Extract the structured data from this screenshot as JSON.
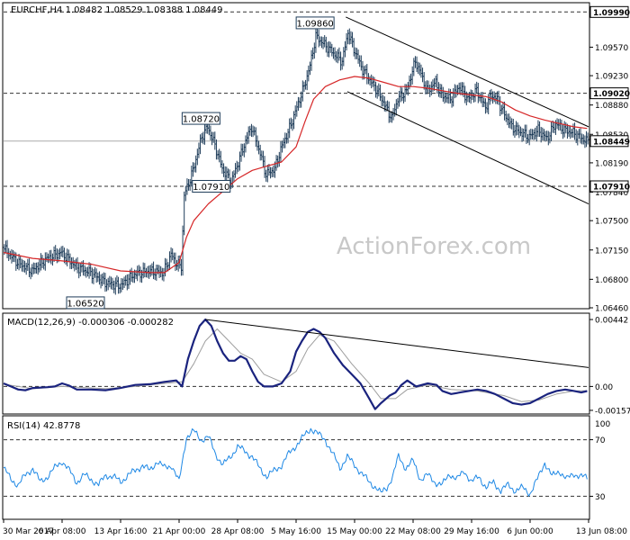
{
  "chart_data": {
    "type": "line",
    "symbol_header": "EURCHF,H4  1.08482 1.08529 1.08388 1.08449",
    "watermark": "ActionForex.com",
    "x_tick_labels": [
      "30 Mar 2017",
      "6 Apr 08:00",
      "13 Apr 16:00",
      "21 Apr 00:00",
      "28 Apr 08:00",
      "5 May 16:00",
      "15 May 00:00",
      "22 May 08:00",
      "29 May 16:00",
      "6 Jun 00:00",
      "13 Jun 08:00"
    ],
    "x_tick_index": [
      0,
      40,
      80,
      120,
      160,
      200,
      240,
      280,
      320,
      360,
      400
    ],
    "bar_count": 400,
    "price": {
      "ylim": [
        1.0646,
        1.1009
      ],
      "y_ticks": [
        1.0999,
        1.0957,
        1.0923,
        1.0888,
        1.0853,
        1.0819,
        1.0784,
        1.075,
        1.0715,
        1.068,
        1.0646
      ],
      "y_tick_labels": [
        "1.09990",
        "1.09570",
        "1.09230",
        "1.08880",
        "1.08530",
        "1.08190",
        "1.07840",
        "1.07500",
        "1.07150",
        "1.06800",
        "1.06460"
      ],
      "close_path": [
        [
          0,
          1.0718
        ],
        [
          10,
          1.07
        ],
        [
          20,
          1.069
        ],
        [
          30,
          1.0705
        ],
        [
          40,
          1.0712
        ],
        [
          50,
          1.0695
        ],
        [
          60,
          1.0688
        ],
        [
          70,
          1.0676
        ],
        [
          80,
          1.0672
        ],
        [
          90,
          1.0686
        ],
        [
          100,
          1.069
        ],
        [
          110,
          1.0688
        ],
        [
          115,
          1.071
        ],
        [
          118,
          1.07
        ],
        [
          122,
          1.0695
        ],
        [
          124,
          1.078
        ],
        [
          130,
          1.081
        ],
        [
          136,
          1.085
        ],
        [
          140,
          1.0862
        ],
        [
          145,
          1.084
        ],
        [
          150,
          1.0812
        ],
        [
          156,
          1.0796
        ],
        [
          160,
          1.0815
        ],
        [
          166,
          1.0845
        ],
        [
          170,
          1.0862
        ],
        [
          176,
          1.083
        ],
        [
          180,
          1.0805
        ],
        [
          186,
          1.0812
        ],
        [
          190,
          1.0835
        ],
        [
          196,
          1.086
        ],
        [
          200,
          1.088
        ],
        [
          206,
          1.091
        ],
        [
          210,
          1.0935
        ],
        [
          214,
          1.097
        ],
        [
          220,
          1.096
        ],
        [
          226,
          1.095
        ],
        [
          232,
          1.094
        ],
        [
          236,
          1.0975
        ],
        [
          240,
          1.0955
        ],
        [
          246,
          1.093
        ],
        [
          250,
          1.092
        ],
        [
          256,
          1.0905
        ],
        [
          262,
          1.0885
        ],
        [
          266,
          1.0872
        ],
        [
          270,
          1.0895
        ],
        [
          276,
          1.0905
        ],
        [
          282,
          1.094
        ],
        [
          286,
          1.0925
        ],
        [
          290,
          1.0905
        ],
        [
          296,
          1.0915
        ],
        [
          300,
          1.09
        ],
        [
          306,
          1.0895
        ],
        [
          312,
          1.091
        ],
        [
          318,
          1.0895
        ],
        [
          324,
          1.0905
        ],
        [
          330,
          1.0885
        ],
        [
          334,
          1.09
        ],
        [
          338,
          1.0895
        ],
        [
          342,
          1.088
        ],
        [
          348,
          1.0862
        ],
        [
          354,
          1.0855
        ],
        [
          360,
          1.085
        ],
        [
          366,
          1.0858
        ],
        [
          372,
          1.0848
        ],
        [
          378,
          1.0866
        ],
        [
          384,
          1.0858
        ],
        [
          390,
          1.0855
        ],
        [
          394,
          1.085
        ],
        [
          399,
          1.08449
        ]
      ],
      "sma_path": [
        [
          0,
          1.0712
        ],
        [
          20,
          1.0705
        ],
        [
          40,
          1.0702
        ],
        [
          60,
          1.0698
        ],
        [
          80,
          1.069
        ],
        [
          100,
          1.0688
        ],
        [
          110,
          1.0688
        ],
        [
          120,
          1.07
        ],
        [
          125,
          1.073
        ],
        [
          130,
          1.075
        ],
        [
          140,
          1.077
        ],
        [
          150,
          1.0785
        ],
        [
          160,
          1.08
        ],
        [
          170,
          1.081
        ],
        [
          180,
          1.0815
        ],
        [
          190,
          1.082
        ],
        [
          200,
          1.0838
        ],
        [
          206,
          1.0868
        ],
        [
          212,
          1.0895
        ],
        [
          220,
          1.091
        ],
        [
          230,
          1.0918
        ],
        [
          240,
          1.0922
        ],
        [
          250,
          1.092
        ],
        [
          260,
          1.0915
        ],
        [
          270,
          1.091
        ],
        [
          280,
          1.091
        ],
        [
          290,
          1.0908
        ],
        [
          300,
          1.0905
        ],
        [
          310,
          1.0902
        ],
        [
          320,
          1.09
        ],
        [
          330,
          1.0898
        ],
        [
          340,
          1.0892
        ],
        [
          350,
          1.0882
        ],
        [
          360,
          1.0875
        ],
        [
          370,
          1.087
        ],
        [
          380,
          1.0866
        ],
        [
          390,
          1.0862
        ],
        [
          399,
          1.086
        ]
      ],
      "sma_color": "#d62728",
      "bar_color": "#1f3d5a",
      "horizontal_levels": [
        1.0999,
        1.0902,
        1.0791
      ],
      "current_level": 1.08449,
      "channel_upper": [
        [
          234,
          1.0993
        ],
        [
          400,
          1.0862
        ]
      ],
      "channel_lower": [
        [
          235,
          1.0904
        ],
        [
          400,
          1.077
        ]
      ],
      "callouts": [
        {
          "label": "1.09860",
          "x": 213,
          "value": 1.0986
        },
        {
          "label": "1.08720",
          "x": 135,
          "value": 1.0872
        },
        {
          "label": "1.07910",
          "x": 142,
          "value": 1.0791
        },
        {
          "label": "1.06520",
          "x": 56,
          "value": 1.0652
        }
      ],
      "right_labels": [
        {
          "label": "1.09990",
          "value": 1.0999,
          "highlight": true
        },
        {
          "label": "1.09020",
          "value": 1.0902,
          "highlight": true
        },
        {
          "label": "1.08449",
          "value": 1.08449,
          "highlight": true
        },
        {
          "label": "1.07910",
          "value": 1.0791,
          "highlight": true
        }
      ]
    },
    "macd": {
      "title": "MACD(12,26,9) -0.000306 -0.000282",
      "ylim": [
        -0.0017,
        0.0046
      ],
      "y_ticks": [
        0.00442,
        0.0,
        -0.001578
      ],
      "y_tick_labels": [
        "0.00442",
        "0.00",
        "-0.001578"
      ],
      "macd_path": [
        [
          0,
          0.0002
        ],
        [
          5,
          0.0
        ],
        [
          10,
          -0.0002
        ],
        [
          15,
          -0.00025
        ],
        [
          20,
          -0.0001
        ],
        [
          30,
          -5e-05
        ],
        [
          35,
          0.0
        ],
        [
          40,
          0.0002
        ],
        [
          45,
          5e-05
        ],
        [
          50,
          -0.0002
        ],
        [
          60,
          -0.0002
        ],
        [
          70,
          -0.00025
        ],
        [
          80,
          -0.0001
        ],
        [
          90,
          0.0001
        ],
        [
          100,
          0.00015
        ],
        [
          110,
          0.0003
        ],
        [
          118,
          0.0004
        ],
        [
          122,
          0.0
        ],
        [
          126,
          0.0018
        ],
        [
          130,
          0.003
        ],
        [
          134,
          0.004
        ],
        [
          138,
          0.00442
        ],
        [
          142,
          0.004
        ],
        [
          146,
          0.003
        ],
        [
          150,
          0.0022
        ],
        [
          154,
          0.0017
        ],
        [
          158,
          0.0017
        ],
        [
          162,
          0.002
        ],
        [
          166,
          0.0018
        ],
        [
          170,
          0.001
        ],
        [
          174,
          0.0003
        ],
        [
          178,
          0.0
        ],
        [
          184,
          0.0
        ],
        [
          190,
          0.0002
        ],
        [
          196,
          0.001
        ],
        [
          200,
          0.0023
        ],
        [
          204,
          0.003
        ],
        [
          208,
          0.0036
        ],
        [
          212,
          0.0038
        ],
        [
          216,
          0.0036
        ],
        [
          220,
          0.0032
        ],
        [
          226,
          0.0022
        ],
        [
          232,
          0.0014
        ],
        [
          238,
          0.0008
        ],
        [
          244,
          0.0002
        ],
        [
          250,
          -0.0008
        ],
        [
          254,
          -0.0015
        ],
        [
          258,
          -0.0011
        ],
        [
          264,
          -0.0006
        ],
        [
          268,
          -0.0004
        ],
        [
          272,
          0.0001
        ],
        [
          276,
          0.0004
        ],
        [
          282,
          0.0
        ],
        [
          290,
          0.0002
        ],
        [
          296,
          0.0001
        ],
        [
          300,
          -0.0003
        ],
        [
          306,
          -0.0005
        ],
        [
          312,
          -0.0004
        ],
        [
          318,
          -0.0003
        ],
        [
          324,
          -0.0002
        ],
        [
          330,
          -0.0003
        ],
        [
          336,
          -0.0005
        ],
        [
          342,
          -0.0008
        ],
        [
          348,
          -0.0011
        ],
        [
          354,
          -0.0012
        ],
        [
          360,
          -0.0011
        ],
        [
          366,
          -0.0008
        ],
        [
          372,
          -0.0005
        ],
        [
          378,
          -0.0003
        ],
        [
          384,
          -0.0002
        ],
        [
          390,
          -0.0003
        ],
        [
          395,
          -0.0004
        ],
        [
          399,
          -0.000306
        ]
      ],
      "signal_path": [
        [
          0,
          0.00015
        ],
        [
          10,
          0.0
        ],
        [
          20,
          -0.00015
        ],
        [
          40,
          0.0
        ],
        [
          50,
          -5e-05
        ],
        [
          70,
          -0.00015
        ],
        [
          90,
          0.0
        ],
        [
          110,
          0.0002
        ],
        [
          122,
          0.0003
        ],
        [
          130,
          0.0015
        ],
        [
          138,
          0.003
        ],
        [
          146,
          0.0038
        ],
        [
          154,
          0.003
        ],
        [
          162,
          0.0022
        ],
        [
          170,
          0.0018
        ],
        [
          178,
          0.0008
        ],
        [
          190,
          0.0003
        ],
        [
          200,
          0.001
        ],
        [
          208,
          0.0025
        ],
        [
          216,
          0.0034
        ],
        [
          226,
          0.003
        ],
        [
          238,
          0.0015
        ],
        [
          250,
          0.0002
        ],
        [
          258,
          -0.0008
        ],
        [
          268,
          -0.0008
        ],
        [
          276,
          -0.0002
        ],
        [
          290,
          0.0001
        ],
        [
          306,
          -0.0002
        ],
        [
          324,
          -0.0003
        ],
        [
          342,
          -0.0006
        ],
        [
          354,
          -0.001
        ],
        [
          366,
          -0.0009
        ],
        [
          378,
          -0.0005
        ],
        [
          390,
          -0.0003
        ],
        [
          399,
          -0.000282
        ]
      ],
      "trendline": [
        [
          138,
          0.00442
        ],
        [
          400,
          0.00125
        ]
      ],
      "macd_color": "#1a237e",
      "signal_color": "#9e9e9e"
    },
    "rsi": {
      "title": "RSI(14) 42.8778",
      "ylim": [
        15,
        85
      ],
      "y_ticks": [
        70,
        30
      ],
      "y_tick_labels": [
        "70",
        "30"
      ],
      "extra_tick": {
        "value": 100,
        "label": "100"
      },
      "rsi_path": [
        [
          0,
          50
        ],
        [
          5,
          42
        ],
        [
          10,
          38
        ],
        [
          15,
          45
        ],
        [
          20,
          50
        ],
        [
          25,
          40
        ],
        [
          30,
          44
        ],
        [
          35,
          50
        ],
        [
          40,
          55
        ],
        [
          45,
          48
        ],
        [
          50,
          40
        ],
        [
          55,
          45
        ],
        [
          60,
          42
        ],
        [
          65,
          38
        ],
        [
          70,
          45
        ],
        [
          75,
          44
        ],
        [
          80,
          40
        ],
        [
          85,
          45
        ],
        [
          90,
          48
        ],
        [
          95,
          52
        ],
        [
          100,
          48
        ],
        [
          105,
          55
        ],
        [
          110,
          50
        ],
        [
          115,
          52
        ],
        [
          120,
          40
        ],
        [
          125,
          72
        ],
        [
          130,
          76
        ],
        [
          135,
          70
        ],
        [
          140,
          72
        ],
        [
          145,
          60
        ],
        [
          150,
          52
        ],
        [
          155,
          58
        ],
        [
          160,
          65
        ],
        [
          165,
          62
        ],
        [
          170,
          58
        ],
        [
          175,
          50
        ],
        [
          180,
          44
        ],
        [
          185,
          48
        ],
        [
          190,
          52
        ],
        [
          195,
          60
        ],
        [
          200,
          66
        ],
        [
          205,
          72
        ],
        [
          210,
          78
        ],
        [
          215,
          74
        ],
        [
          220,
          70
        ],
        [
          225,
          60
        ],
        [
          230,
          50
        ],
        [
          235,
          58
        ],
        [
          240,
          52
        ],
        [
          245,
          46
        ],
        [
          250,
          40
        ],
        [
          255,
          36
        ],
        [
          258,
          32
        ],
        [
          262,
          36
        ],
        [
          266,
          44
        ],
        [
          270,
          58
        ],
        [
          275,
          50
        ],
        [
          280,
          55
        ],
        [
          285,
          42
        ],
        [
          290,
          45
        ],
        [
          295,
          40
        ],
        [
          300,
          38
        ],
        [
          305,
          46
        ],
        [
          310,
          42
        ],
        [
          315,
          48
        ],
        [
          320,
          40
        ],
        [
          325,
          44
        ],
        [
          330,
          36
        ],
        [
          335,
          40
        ],
        [
          340,
          34
        ],
        [
          345,
          38
        ],
        [
          350,
          34
        ],
        [
          355,
          36
        ],
        [
          360,
          32
        ],
        [
          365,
          42
        ],
        [
          370,
          54
        ],
        [
          375,
          44
        ],
        [
          380,
          48
        ],
        [
          385,
          42
        ],
        [
          390,
          46
        ],
        [
          395,
          44
        ],
        [
          399,
          42.8778
        ]
      ],
      "rsi_color": "#1e88e5"
    }
  }
}
